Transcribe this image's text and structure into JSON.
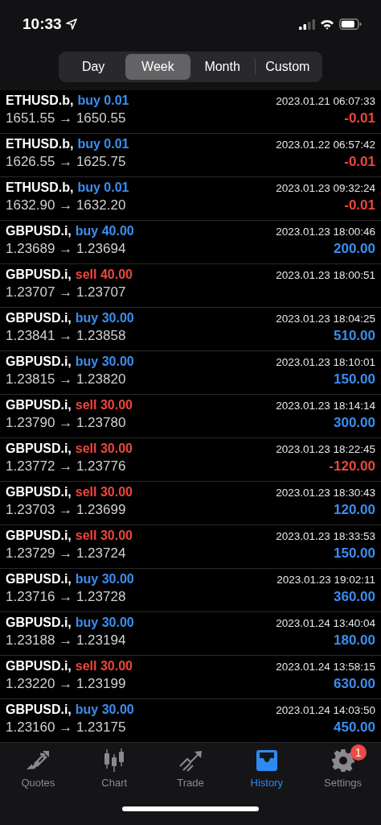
{
  "status_bar": {
    "time": "10:33"
  },
  "periods": [
    {
      "label": "Day",
      "selected": false
    },
    {
      "label": "Week",
      "selected": true
    },
    {
      "label": "Month",
      "selected": false
    },
    {
      "label": "Custom",
      "selected": false
    }
  ],
  "deals": [
    {
      "symbol": "ETHUSD.b,",
      "kind": "buy",
      "order": "buy 0.01",
      "time": "2023.01.21 06:07:33",
      "prices": "1651.55 → 1650.55",
      "loss": true,
      "profit": "-0.01"
    },
    {
      "symbol": "ETHUSD.b,",
      "kind": "buy",
      "order": "buy 0.01",
      "time": "2023.01.22 06:57:42",
      "prices": "1626.55 → 1625.75",
      "loss": true,
      "profit": "-0.01"
    },
    {
      "symbol": "ETHUSD.b,",
      "kind": "buy",
      "order": "buy 0.01",
      "time": "2023.01.23 09:32:24",
      "prices": "1632.90 → 1632.20",
      "loss": true,
      "profit": "-0.01"
    },
    {
      "symbol": "GBPUSD.i,",
      "kind": "buy",
      "order": "buy 40.00",
      "time": "2023.01.23 18:00:46",
      "prices": "1.23689 → 1.23694",
      "loss": false,
      "profit": "200.00"
    },
    {
      "symbol": "GBPUSD.i,",
      "kind": "sell",
      "order": "sell 40.00",
      "time": "2023.01.23 18:00:51",
      "prices": "1.23707 → 1.23707"
    },
    {
      "symbol": "GBPUSD.i,",
      "kind": "buy",
      "order": "buy 30.00",
      "time": "2023.01.23 18:04:25",
      "prices": "1.23841 → 1.23858",
      "loss": false,
      "profit": "510.00"
    },
    {
      "symbol": "GBPUSD.i,",
      "kind": "buy",
      "order": "buy 30.00",
      "time": "2023.01.23 18:10:01",
      "prices": "1.23815 → 1.23820",
      "loss": false,
      "profit": "150.00"
    },
    {
      "symbol": "GBPUSD.i,",
      "kind": "sell",
      "order": "sell 30.00",
      "time": "2023.01.23 18:14:14",
      "prices": "1.23790 → 1.23780",
      "loss": false,
      "profit": "300.00"
    },
    {
      "symbol": "GBPUSD.i,",
      "kind": "sell",
      "order": "sell 30.00",
      "time": "2023.01.23 18:22:45",
      "prices": "1.23772 → 1.23776",
      "loss": true,
      "profit": "-120.00"
    },
    {
      "symbol": "GBPUSD.i,",
      "kind": "sell",
      "order": "sell 30.00",
      "time": "2023.01.23 18:30:43",
      "prices": "1.23703 → 1.23699",
      "loss": false,
      "profit": "120.00"
    },
    {
      "symbol": "GBPUSD.i,",
      "kind": "sell",
      "order": "sell 30.00",
      "time": "2023.01.23 18:33:53",
      "prices": "1.23729 → 1.23724",
      "loss": false,
      "profit": "150.00"
    },
    {
      "symbol": "GBPUSD.i,",
      "kind": "buy",
      "order": "buy 30.00",
      "time": "2023.01.23 19:02:11",
      "prices": "1.23716 → 1.23728",
      "loss": false,
      "profit": "360.00"
    },
    {
      "symbol": "GBPUSD.i,",
      "kind": "buy",
      "order": "buy 30.00",
      "time": "2023.01.24 13:40:04",
      "prices": "1.23188 → 1.23194",
      "loss": false,
      "profit": "180.00"
    },
    {
      "symbol": "GBPUSD.i,",
      "kind": "sell",
      "order": "sell 30.00",
      "time": "2023.01.24 13:58:15",
      "prices": "1.23220 → 1.23199",
      "loss": false,
      "profit": "630.00"
    },
    {
      "symbol": "GBPUSD.i,",
      "kind": "buy",
      "order": "buy 30.00",
      "time": "2023.01.24 14:03:50",
      "prices": "1.23160 → 1.23175",
      "loss": false,
      "profit": "450.00"
    }
  ],
  "tab_bar": [
    {
      "kind": "quotes",
      "label": "Quotes",
      "selected": false
    },
    {
      "kind": "chart",
      "label": "Chart",
      "selected": false
    },
    {
      "kind": "trade",
      "label": "Trade",
      "selected": false
    },
    {
      "kind": "history",
      "label": "History",
      "selected": true
    },
    {
      "kind": "settings",
      "label": "Settings",
      "selected": false,
      "badge": "1"
    }
  ]
}
